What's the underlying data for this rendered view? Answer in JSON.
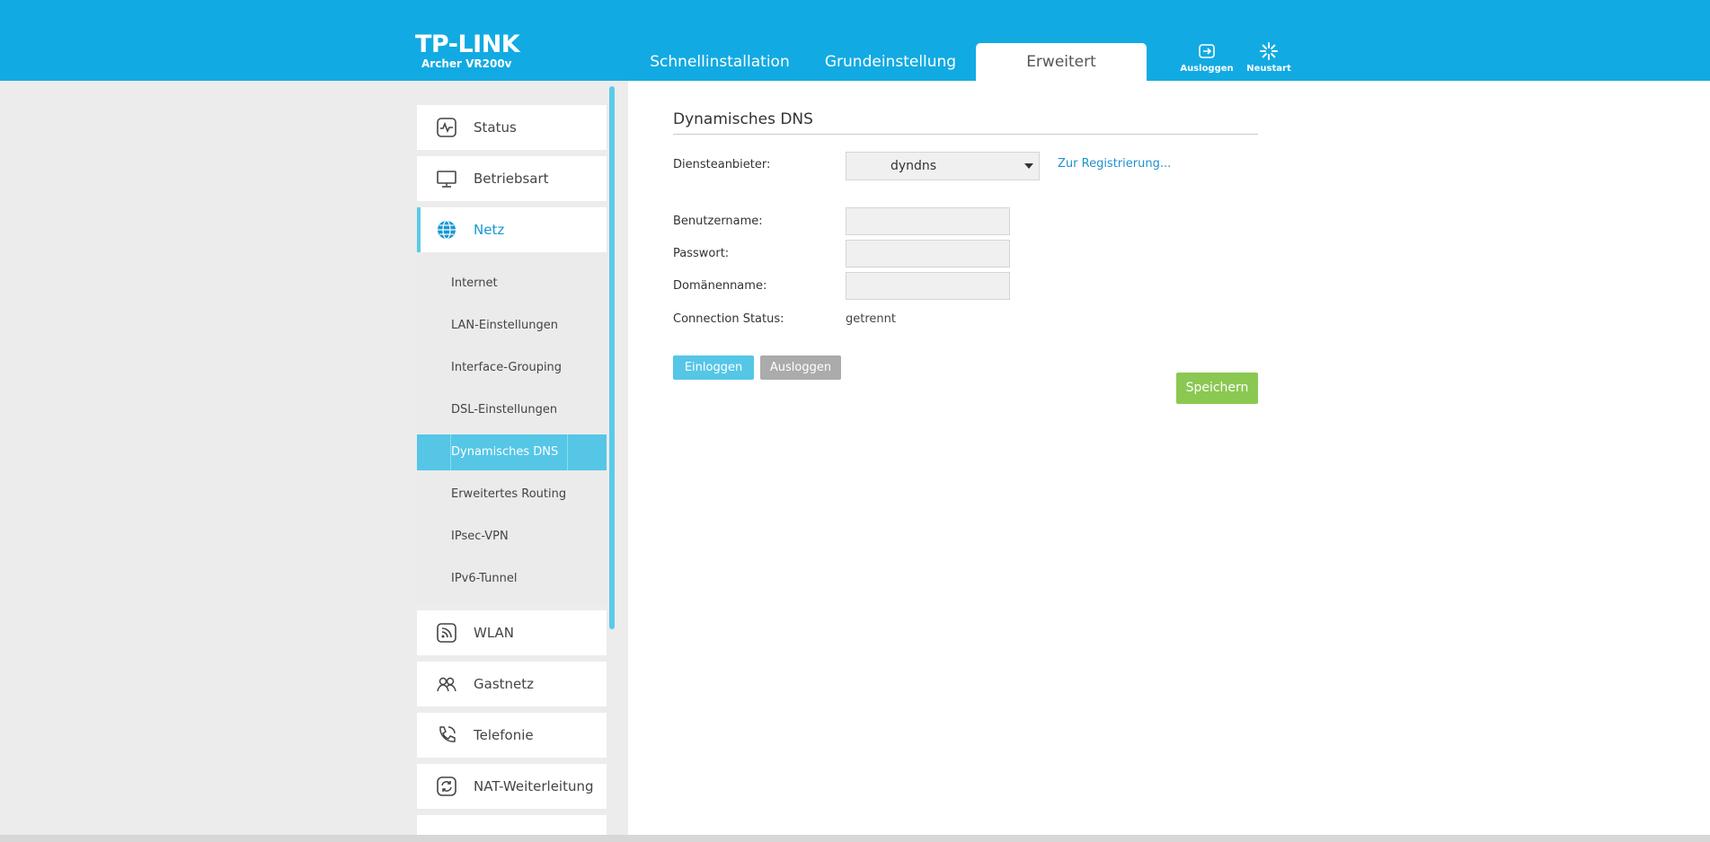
{
  "header": {
    "logo": "TP-LINK",
    "model": "Archer VR200v",
    "tabs": [
      {
        "label": "Schnellinstallation"
      },
      {
        "label": "Grundeinstellung"
      },
      {
        "label": "Erweitert"
      }
    ],
    "logout_label": "Ausloggen",
    "reboot_label": "Neustart"
  },
  "sidebar": {
    "items": [
      {
        "label": "Status",
        "icon": "status-icon"
      },
      {
        "label": "Betriebsart",
        "icon": "monitor-icon"
      },
      {
        "label": "Netz",
        "icon": "globe-icon"
      },
      {
        "label": "WLAN",
        "icon": "wifi-icon"
      },
      {
        "label": "Gastnetz",
        "icon": "guest-network-icon"
      },
      {
        "label": "Telefonie",
        "icon": "phone-icon"
      },
      {
        "label": "NAT-Weiterleitung",
        "icon": "nat-icon"
      }
    ],
    "subitems": [
      {
        "label": "Internet"
      },
      {
        "label": "LAN-Einstellungen"
      },
      {
        "label": "Interface-Grouping"
      },
      {
        "label": "DSL-Einstellungen"
      },
      {
        "label": "Dynamisches DNS"
      },
      {
        "label": "Erweitertes Routing"
      },
      {
        "label": "IPsec-VPN"
      },
      {
        "label": "IPv6-Tunnel"
      }
    ]
  },
  "main": {
    "title": "Dynamisches DNS",
    "provider_label": "Diensteanbieter:",
    "provider_value": "dyndns",
    "register_link": "Zur Registrierung...",
    "username_label": "Benutzername:",
    "username_value": "",
    "password_label": "Passwort:",
    "password_value": "",
    "domain_label": "Domänenname:",
    "domain_value": "",
    "status_label": "Connection Status:",
    "status_value": "getrennt",
    "login_button": "Einloggen",
    "logout_button": "Ausloggen",
    "save_button": "Speichern"
  },
  "colors": {
    "header": "#12aae2",
    "accent": "#55c6e6",
    "save": "#8bc852",
    "link": "#1f8fd0"
  }
}
